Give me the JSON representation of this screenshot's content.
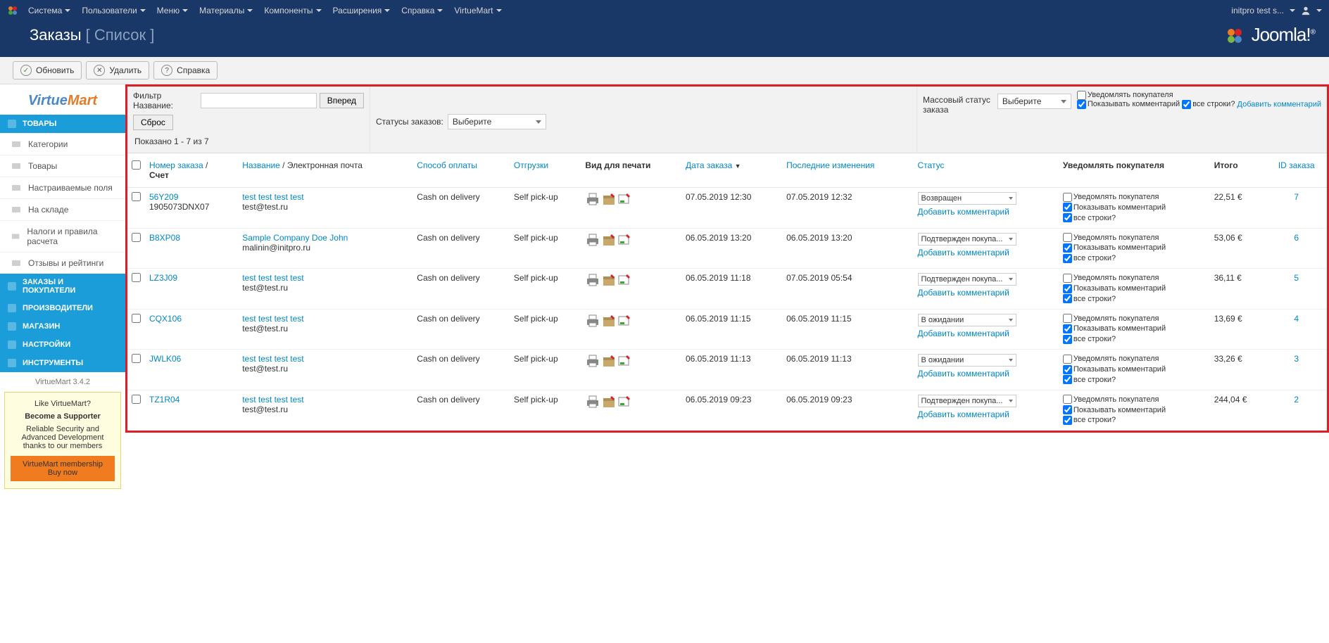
{
  "topnav": {
    "items": [
      "Система",
      "Пользователи",
      "Меню",
      "Материалы",
      "Компоненты",
      "Расширения",
      "Справка",
      "VirtueMart"
    ],
    "user": "initpro test s..."
  },
  "title": {
    "main": "Заказы",
    "sub": "[ Список ]"
  },
  "joomla_logo": "Joomla!",
  "toolbar": {
    "refresh": "Обновить",
    "delete": "Удалить",
    "help": "Справка"
  },
  "sidebar": {
    "logo_part1": "Virtue",
    "logo_part2": "Mart",
    "sections": [
      {
        "head": "ТОВАРЫ",
        "items": [
          "Категории",
          "Товары",
          "Настраиваемые поля",
          "На складе",
          "Налоги и правила расчета",
          "Отзывы и рейтинги"
        ]
      },
      {
        "head": "ЗАКАЗЫ И ПОКУПАТЕЛИ"
      },
      {
        "head": "ПРОИЗВОДИТЕЛИ"
      },
      {
        "head": "МАГАЗИН"
      },
      {
        "head": "НАСТРОЙКИ"
      },
      {
        "head": "ИНСТРУМЕНТЫ"
      }
    ],
    "version": "VirtueMart 3.4.2",
    "promo": {
      "line1": "Like VirtueMart?",
      "line2": "Become a Supporter",
      "line3": "Reliable Security and Advanced Development thanks to our members",
      "btn1": "VirtueMart membership",
      "btn2": "Buy now"
    }
  },
  "filters": {
    "name_label": "Фильтр Название:",
    "go": "Вперед",
    "reset": "Сброс",
    "shown": "Показано 1 - 7 из 7",
    "status_label": "Статусы заказов:",
    "status_value": "Выберите",
    "bulk_label": "Массовый статус заказа",
    "bulk_value": "Выберите",
    "cb_notify": "Уведомлять покупателя",
    "cb_comment": "Показывать комментарий",
    "cb_all": "все строки?",
    "add_comment": "Добавить комментарий"
  },
  "columns": {
    "ordernum": "Номер заказа",
    "invoice": "Счет",
    "slash": " / ",
    "name": "Название",
    "email": "Электронная почта",
    "payment": "Способ оплаты",
    "shipping": "Отгрузки",
    "print": "Вид для печати",
    "date": "Дата заказа",
    "modified": "Последние изменения",
    "status": "Статус",
    "notify": "Уведомлять покупателя",
    "total": "Итого",
    "id": "ID заказа"
  },
  "row_labels": {
    "add_comment": "Добавить комментарий",
    "notify": "Уведомлять покупателя",
    "show_comment": "Показывать комментарий",
    "all_rows": "все строки?"
  },
  "rows": [
    {
      "order": "56Y209",
      "invoice": "1905073DNX07",
      "name": "test test test test",
      "email": "test@test.ru",
      "payment": "Cash on delivery",
      "shipping": "Self pick-up",
      "date": "07.05.2019 12:30",
      "modified": "07.05.2019 12:32",
      "status": "Возвращен",
      "total": "22,51 €",
      "id": "7"
    },
    {
      "order": "B8XP08",
      "invoice": "",
      "name": "Sample Company Doe John",
      "email": "malinin@initpro.ru",
      "payment": "Cash on delivery",
      "shipping": "Self pick-up",
      "date": "06.05.2019 13:20",
      "modified": "06.05.2019 13:20",
      "status": "Подтвержден покупа...",
      "total": "53,06 €",
      "id": "6"
    },
    {
      "order": "LZ3J09",
      "invoice": "",
      "name": "test test test test",
      "email": "test@test.ru",
      "payment": "Cash on delivery",
      "shipping": "Self pick-up",
      "date": "06.05.2019 11:18",
      "modified": "07.05.2019 05:54",
      "status": "Подтвержден покупа...",
      "total": "36,11 €",
      "id": "5"
    },
    {
      "order": "CQX106",
      "invoice": "",
      "name": "test test test test",
      "email": "test@test.ru",
      "payment": "Cash on delivery",
      "shipping": "Self pick-up",
      "date": "06.05.2019 11:15",
      "modified": "06.05.2019 11:15",
      "status": "В ожидании",
      "total": "13,69 €",
      "id": "4"
    },
    {
      "order": "JWLK06",
      "invoice": "",
      "name": "test test test test",
      "email": "test@test.ru",
      "payment": "Cash on delivery",
      "shipping": "Self pick-up",
      "date": "06.05.2019 11:13",
      "modified": "06.05.2019 11:13",
      "status": "В ожидании",
      "total": "33,26 €",
      "id": "3"
    },
    {
      "order": "TZ1R04",
      "invoice": "",
      "name": "test test test test",
      "email": "test@test.ru",
      "payment": "Cash on delivery",
      "shipping": "Self pick-up",
      "date": "06.05.2019 09:23",
      "modified": "06.05.2019 09:23",
      "status": "Подтвержден покупа...",
      "total": "244,04 €",
      "id": "2"
    }
  ]
}
